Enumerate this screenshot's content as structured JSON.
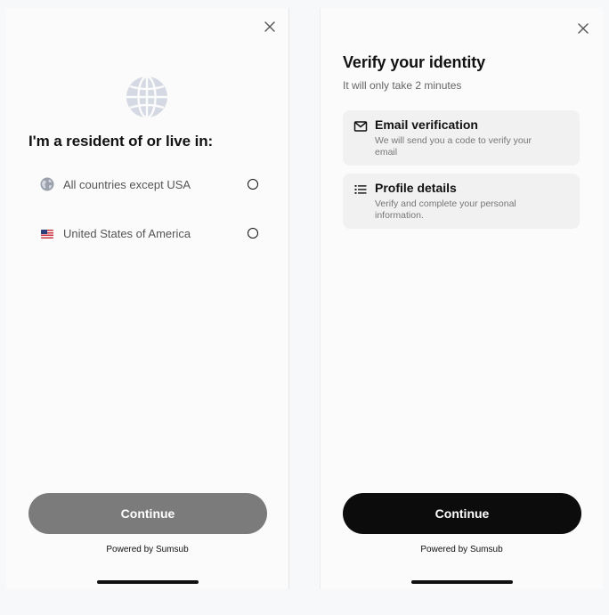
{
  "left_screen": {
    "title": "I'm a resident of or live in:",
    "options": [
      {
        "label": "All countries except USA",
        "icon": "globe-icon",
        "selected": false
      },
      {
        "label": "United States of America",
        "icon": "us-flag-icon",
        "selected": false
      }
    ],
    "continue_label": "Continue",
    "powered_by": "Powered by Sumsub"
  },
  "right_screen": {
    "title": "Verify your identity",
    "subtitle": "It will only take 2 minutes",
    "steps": [
      {
        "title": "Email verification",
        "description": "We will send you a code to verify your email",
        "icon": "envelope-icon"
      },
      {
        "title": "Profile details",
        "description": "Verify and complete your personal information.",
        "icon": "list-icon"
      }
    ],
    "continue_label": "Continue",
    "powered_by": "Powered by Sumsub"
  },
  "colors": {
    "page_background": "#f7f8fa",
    "screen_background": "#fbfbfb",
    "primary_button": "#0c0c0c",
    "disabled_button": "#7b7b7b",
    "card_background": "#f1f1f1",
    "globe": "#d5d9e3"
  }
}
